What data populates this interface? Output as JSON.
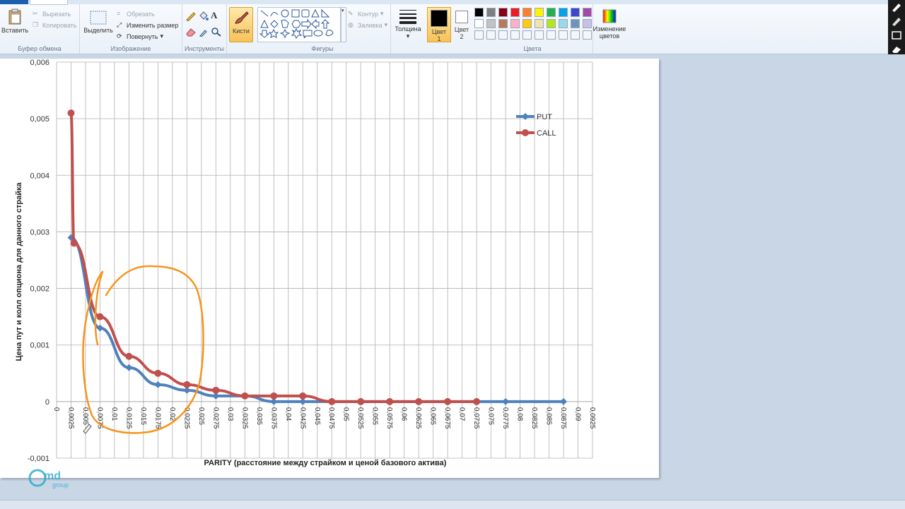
{
  "ribbon": {
    "clipboard": {
      "label": "Буфер обмена",
      "paste": "Вставить",
      "cut": "Вырезать",
      "copy": "Копировать"
    },
    "image": {
      "label": "Изображение",
      "select": "Выделить",
      "crop": "Обрезать",
      "resize": "Изменить размер",
      "rotate": "Повернуть"
    },
    "tools": {
      "label": "Инструменты"
    },
    "brushes": {
      "label": "Кисти"
    },
    "shapes": {
      "label": "Фигуры",
      "outline": "Контур",
      "fill": "Заливка"
    },
    "thickness": {
      "label": "Толщина"
    },
    "color1": {
      "label": "Цвет",
      "num": "1"
    },
    "color2": {
      "label": "Цвет",
      "num": "2"
    },
    "colors": {
      "label": "Цвета"
    },
    "edit_colors": {
      "line1": "Изменение",
      "line2": "цветов"
    },
    "palette_row1": [
      "#000000",
      "#7f7f7f",
      "#880015",
      "#ed1c24",
      "#ff7f27",
      "#fff200",
      "#22b14c",
      "#00a2e8",
      "#3f48cc",
      "#a349a4"
    ],
    "palette_row2": [
      "#ffffff",
      "#c3c3c3",
      "#b97a57",
      "#ffaec9",
      "#ffc90e",
      "#efe4b0",
      "#b5e61d",
      "#99d9ea",
      "#7092be",
      "#c8bfe7"
    ]
  },
  "chart_data": {
    "type": "line",
    "ylabel": "Цена пут и колл опциона для данного страйка",
    "xlabel": "PARITY (расстояние между страйком и ценой базового актива)",
    "ylim": [
      -0.001,
      0.006
    ],
    "yticks": [
      "-0,001",
      "0",
      "0,001",
      "0,002",
      "0,003",
      "0,004",
      "0,005",
      "0,006"
    ],
    "ytick_values": [
      -0.001,
      0,
      0.001,
      0.002,
      0.003,
      0.004,
      0.005,
      0.006
    ],
    "categories": [
      "0",
      "0,0025",
      "0,005",
      "0,0075",
      "0,01",
      "0,0125",
      "0,015",
      "0,0175",
      "0,02",
      "0,0225",
      "0,025",
      "0,0275",
      "0,03",
      "0,0325",
      "0,035",
      "0,0375",
      "0,04",
      "0,0425",
      "0,045",
      "0,0475",
      "0,05",
      "0,0525",
      "0,055",
      "0,0575",
      "0,06",
      "0,0625",
      "0,065",
      "0,0675",
      "0,07",
      "0,0725",
      "0,075",
      "0,0775",
      "0,08",
      "0,0825",
      "0,085",
      "0,0875",
      "0,09",
      "0,0925"
    ],
    "legend_position": "right",
    "grid": true,
    "series": [
      {
        "name": "PUT",
        "color": "#4f81bd",
        "marker": "diamond",
        "points": [
          [
            1,
            0.0029
          ],
          [
            3,
            0.0013
          ],
          [
            5,
            0.0006
          ],
          [
            7,
            0.0003
          ],
          [
            9,
            0.0002
          ],
          [
            11,
            0.0001
          ],
          [
            13,
            0.0001
          ],
          [
            15,
            0.0
          ],
          [
            17,
            0.0
          ],
          [
            19,
            0.0
          ],
          [
            21,
            0.0
          ],
          [
            23,
            0.0
          ],
          [
            25,
            0.0
          ],
          [
            27,
            0.0
          ],
          [
            29,
            0.0
          ],
          [
            31,
            0.0
          ],
          [
            35,
            0.0
          ]
        ]
      },
      {
        "name": "CALL",
        "color": "#c0504d",
        "marker": "circle",
        "points": [
          [
            1,
            0.0051
          ],
          [
            1.2,
            0.0028
          ],
          [
            3,
            0.0015
          ],
          [
            5,
            0.0008
          ],
          [
            7,
            0.0005
          ],
          [
            9,
            0.0003
          ],
          [
            11,
            0.0002
          ],
          [
            13,
            0.0001
          ],
          [
            15,
            0.0001
          ],
          [
            17,
            0.0001
          ],
          [
            19,
            0.0
          ],
          [
            21,
            0.0
          ],
          [
            23,
            0.0
          ],
          [
            25,
            0.0
          ],
          [
            27,
            0.0
          ],
          [
            29,
            0.0
          ]
        ]
      }
    ]
  },
  "watermark": {
    "brand": "md",
    "sub": "group"
  }
}
